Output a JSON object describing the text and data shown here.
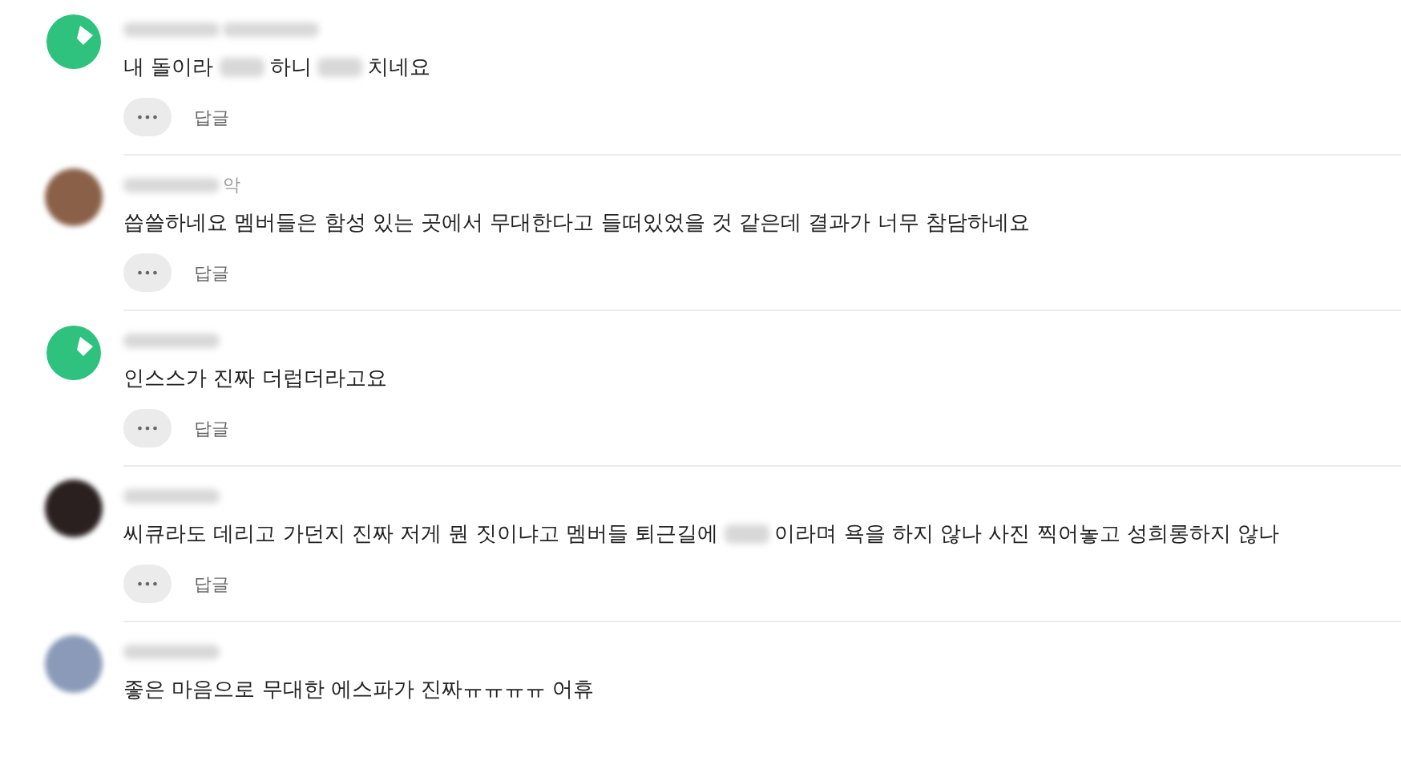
{
  "comments": [
    {
      "avatar": {
        "kind": "logo",
        "color": "#2ec27e"
      },
      "name": [
        {
          "kind": "redacted"
        },
        {
          "kind": "redacted"
        }
      ],
      "body": [
        {
          "kind": "text",
          "text": "내 돌이라 "
        },
        {
          "kind": "redacted"
        },
        {
          "kind": "text",
          "text": "하니 "
        },
        {
          "kind": "redacted"
        },
        {
          "kind": "text",
          "text": "치네요"
        }
      ],
      "more": "•••",
      "reply": "답글"
    },
    {
      "avatar": {
        "kind": "photo",
        "color": "#8a6048"
      },
      "name": [
        {
          "kind": "redacted"
        },
        {
          "kind": "text",
          "text": "악"
        }
      ],
      "body": [
        {
          "kind": "text",
          "text": "씁쓸하네요 멤버들은 함성 있는 곳에서 무대한다고 들떠있었을 것 같은데 결과가 너무 참담하네요"
        }
      ],
      "more": "•••",
      "reply": "답글"
    },
    {
      "avatar": {
        "kind": "logo",
        "color": "#2ec27e"
      },
      "name": [
        {
          "kind": "redacted"
        }
      ],
      "body": [
        {
          "kind": "text",
          "text": "인스스가 진짜 더럽더라고요"
        }
      ],
      "more": "•••",
      "reply": "답글"
    },
    {
      "avatar": {
        "kind": "photo",
        "color": "#2a2020"
      },
      "name": [
        {
          "kind": "redacted"
        }
      ],
      "body": [
        {
          "kind": "text",
          "text": "씨큐라도 데리고 가던지 진짜 저게 뭔 짓이냐고 멤버들 퇴근길에 "
        },
        {
          "kind": "redacted"
        },
        {
          "kind": "text",
          "text": "이라며 욕을 하지 않나 사진 찍어놓고 성희롱하지 않나"
        }
      ],
      "more": "•••",
      "reply": "답글"
    },
    {
      "avatar": {
        "kind": "photo",
        "color": "#8a9ab8"
      },
      "name": [
        {
          "kind": "redacted"
        }
      ],
      "body": [
        {
          "kind": "text",
          "text": "좋은 마음으로 무대한 에스파가 진짜ㅠㅠㅠㅠ 어휴"
        }
      ]
    }
  ]
}
